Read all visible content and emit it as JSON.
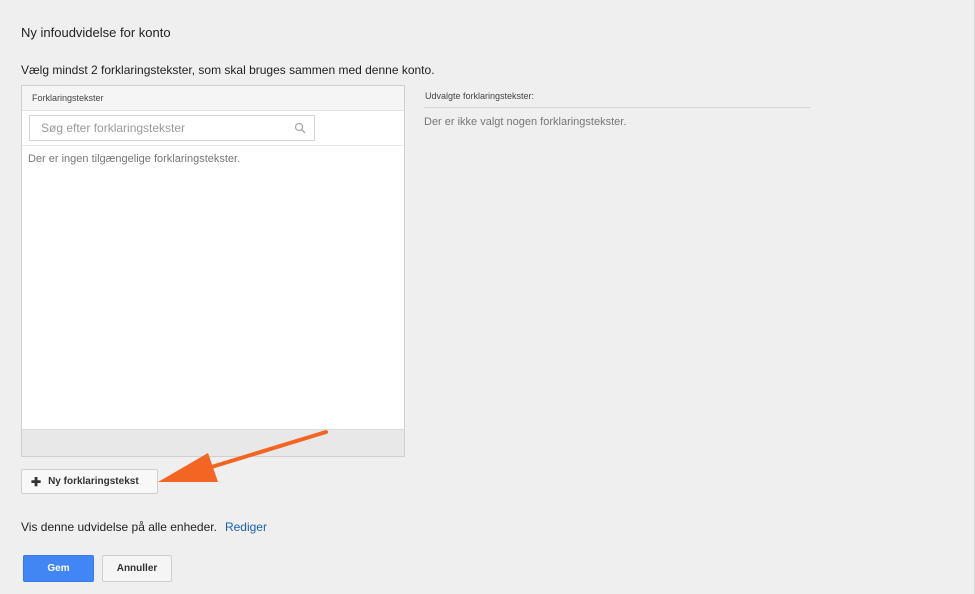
{
  "page": {
    "title": "Ny infoudvidelse for konto",
    "instruction": "Vælg mindst 2 forklaringstekster, som skal bruges sammen med denne konto."
  },
  "left_panel": {
    "header": "Forklaringstekster",
    "search_placeholder": "Søg efter forklaringstekster",
    "empty_message": "Der er ingen tilgængelige forklaringstekster."
  },
  "right_panel": {
    "header": "Udvalgte forklaringstekster:",
    "empty_message": "Der er ikke valgt nogen forklaringstekster."
  },
  "new_button": {
    "icon": "plus-icon",
    "label": "Ny forklaringstekst"
  },
  "devices": {
    "text": "Vis denne udvidelse på alle enheder.",
    "edit_link": "Rediger"
  },
  "actions": {
    "save_label": "Gem",
    "cancel_label": "Annuller"
  },
  "colors": {
    "primary_button": "#4285f4",
    "link": "#1a5fb4",
    "arrow": "#f26522"
  }
}
